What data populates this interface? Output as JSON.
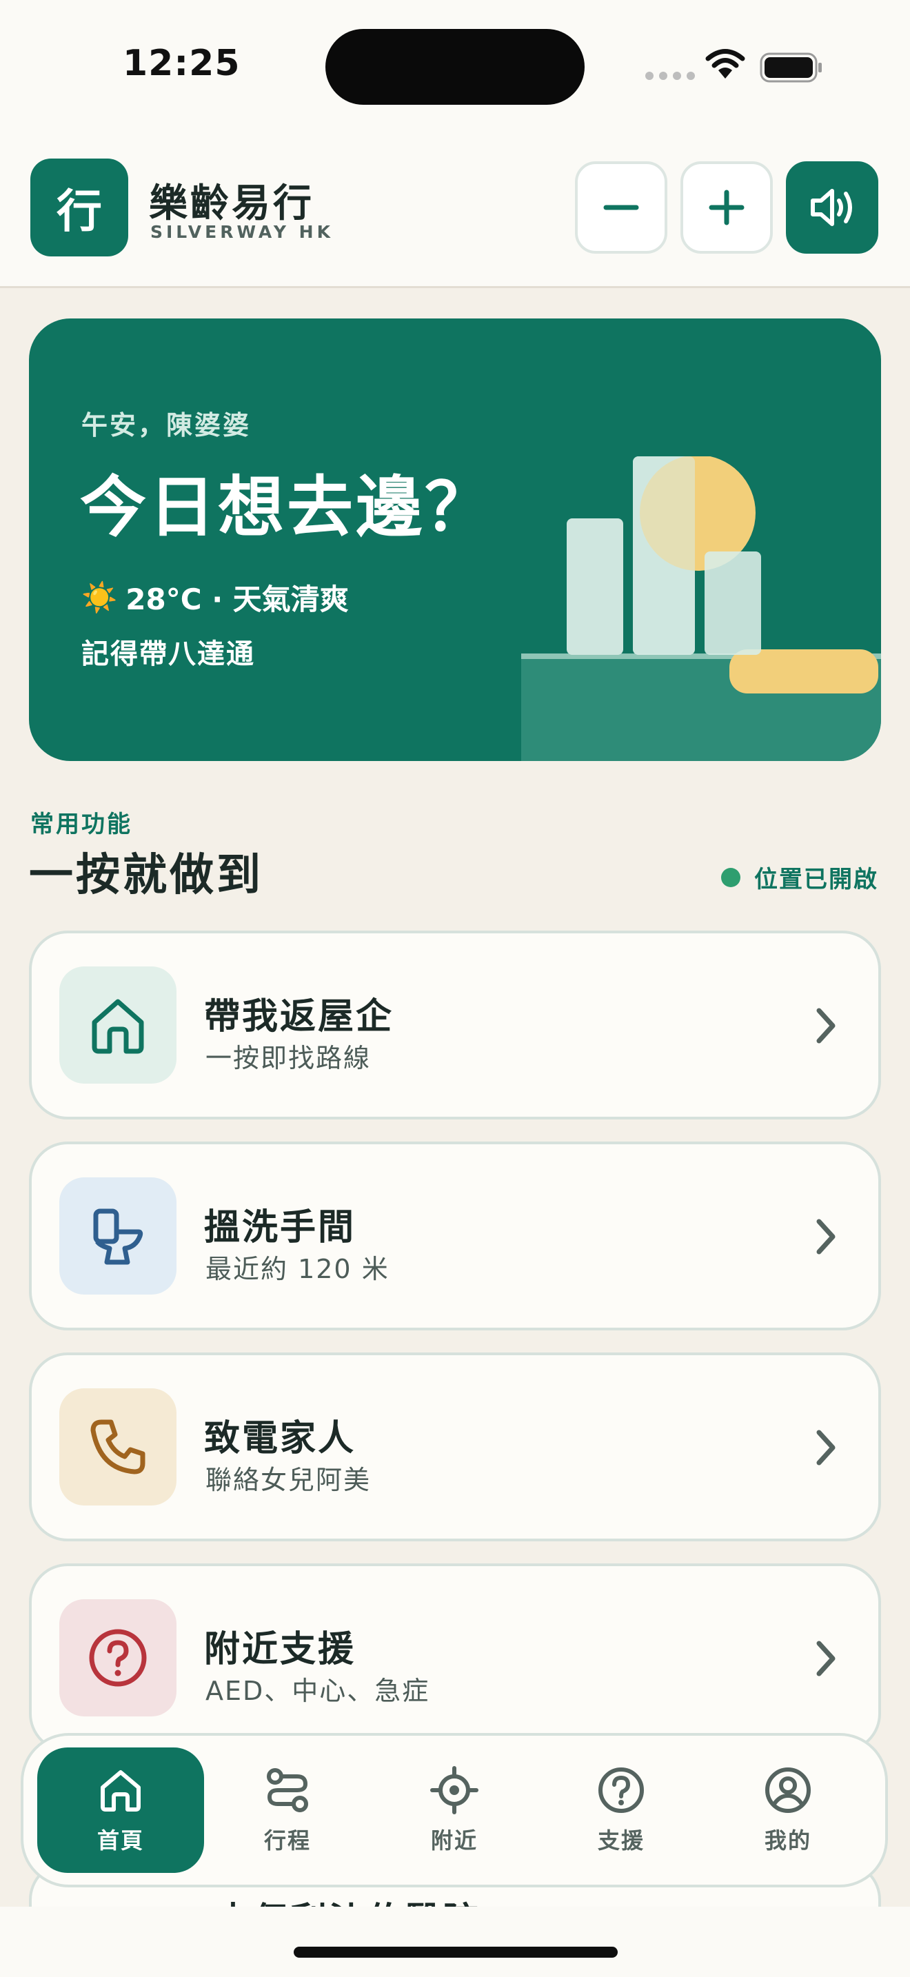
{
  "status_bar": {
    "time": "12:25"
  },
  "header": {
    "logo_char": "行",
    "app_name": "樂齡易行",
    "app_subtitle": "SILVERWAY HK",
    "buttons": {
      "decrease_text_icon": "minus-icon",
      "increase_text_icon": "plus-icon",
      "read_aloud_icon": "speaker-icon"
    }
  },
  "hero": {
    "greeting": "午安，陳婆婆",
    "title": "今日想去邊？",
    "weather_icon": "☀️",
    "weather": "28°C · 天氣清爽",
    "reminder": "記得帶八達通"
  },
  "section": {
    "eyebrow": "常用功能",
    "title": "一按就做到",
    "location_status": "位置已開啟"
  },
  "actions": [
    {
      "title": "帶我返屋企",
      "subtitle": "一按即找路線",
      "icon": "home-icon",
      "icon_bg": "#e2f0ea",
      "icon_color": "#0f7460"
    },
    {
      "title": "搵洗手間",
      "subtitle": "最近約 120 米",
      "icon": "toilet-icon",
      "icon_bg": "#e1ecf5",
      "icon_color": "#2f5f8f"
    },
    {
      "title": "致電家人",
      "subtitle": "聯絡女兒阿美",
      "icon": "phone-icon",
      "icon_bg": "#f5ead4",
      "icon_color": "#a0641f"
    },
    {
      "title": "附近支援",
      "subtitle": "AED、中心、急症",
      "icon": "help-icon",
      "icon_bg": "#f3e1e2",
      "icon_color": "#b8343c"
    }
  ],
  "peek_card": {
    "title": "去伊利沙伯醫院"
  },
  "tabbar": {
    "tabs": [
      {
        "label": "首頁",
        "icon": "home-icon",
        "active": true
      },
      {
        "label": "行程",
        "icon": "route-icon",
        "active": false
      },
      {
        "label": "附近",
        "icon": "locate-icon",
        "active": false
      },
      {
        "label": "支援",
        "icon": "help-icon",
        "active": false
      },
      {
        "label": "我的",
        "icon": "profile-icon",
        "active": false
      }
    ]
  },
  "colors": {
    "primary": "#0f7460",
    "background": "#f4f0e8",
    "surface": "#fdfcf8",
    "location_dot": "#2e9e6f"
  }
}
